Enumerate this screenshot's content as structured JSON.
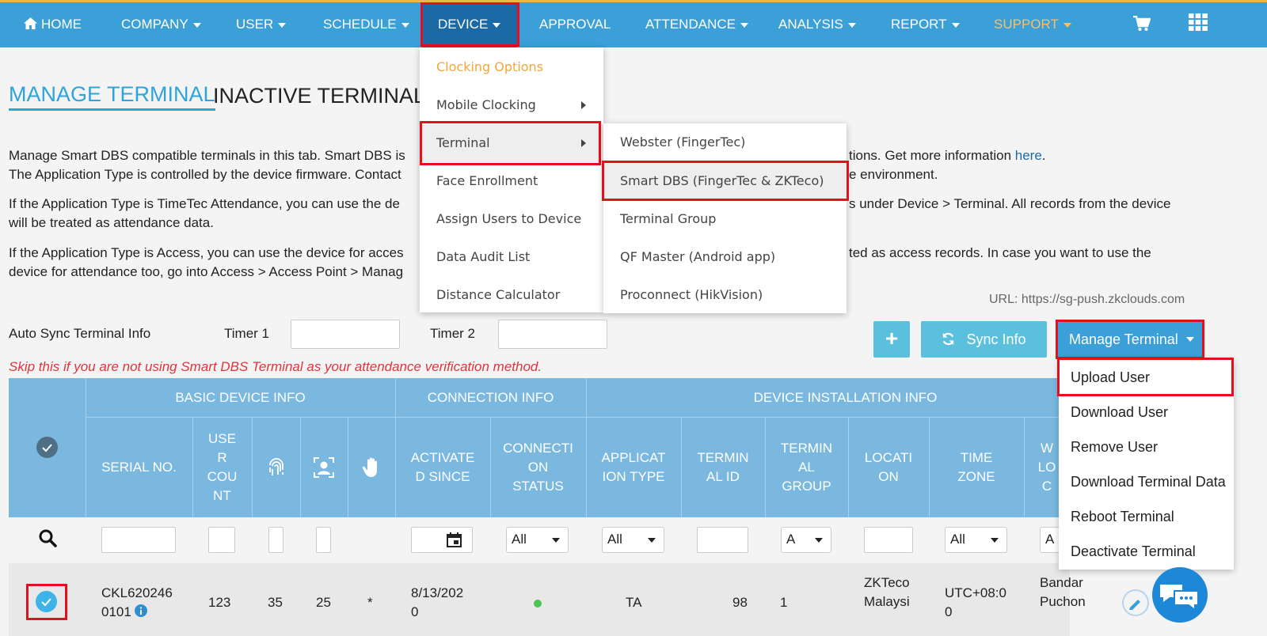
{
  "nav": {
    "items": [
      {
        "label": "HOME",
        "caret": false
      },
      {
        "label": "COMPANY",
        "caret": true
      },
      {
        "label": "USER",
        "caret": true
      },
      {
        "label": "SCHEDULE",
        "caret": true
      },
      {
        "label": "DEVICE",
        "caret": true
      },
      {
        "label": "APPROVAL",
        "caret": false
      },
      {
        "label": "ATTENDANCE",
        "caret": true
      },
      {
        "label": "ANALYSIS",
        "caret": true
      },
      {
        "label": "REPORT",
        "caret": true
      },
      {
        "label": "SUPPORT",
        "caret": true
      }
    ],
    "icons": [
      "home-icon",
      "cart-icon",
      "grid-apps-icon"
    ],
    "colors": {
      "bar": "#3b9fd8",
      "active": "#1b6aa5",
      "support": "#f5c26b",
      "accent": "#e7b84a"
    }
  },
  "tabs": {
    "manage": "MANAGE TERMINAL",
    "inactive": "INACTIVE TERMINAL"
  },
  "intro": {
    "line1a": "Manage Smart DBS compatible terminals in this tab. Smart DBS is",
    "line1b": "tions. Get more information",
    "line1_link": "here",
    "line1_end": ".",
    "line2a": "The Application Type is controlled by the device firmware. Contact",
    "line2b": "e environment.",
    "p2a": "If the Application Type is TimeTec Attendance, you can use the de",
    "p2b": "s under Device > Terminal. All records from the device",
    "p2c": "will be treated as attendance data.",
    "p3a": "If the Application Type is Access, you can use the device for acces",
    "p3b": "ted as access records. In case you want to use the",
    "p3c": "device for attendance too, go into Access > Access Point > Manag"
  },
  "device_menu": {
    "items": [
      {
        "label": "Clocking Options",
        "submenu": false
      },
      {
        "label": "Mobile Clocking",
        "submenu": true
      },
      {
        "label": "Terminal",
        "submenu": true
      },
      {
        "label": "Face Enrollment",
        "submenu": false
      },
      {
        "label": "Assign Users to Device",
        "submenu": false
      },
      {
        "label": "Data Audit List",
        "submenu": false
      },
      {
        "label": "Distance Calculator",
        "submenu": false
      }
    ]
  },
  "terminal_submenu": {
    "items": [
      "Webster (FingerTec)",
      "Smart DBS (FingerTec & ZKTeco)",
      "Terminal Group",
      "QF Master (Android app)",
      "Proconnect (HikVision)"
    ]
  },
  "url_text": "URL: https://sg-push.zkclouds.com",
  "sync": {
    "label": "Auto Sync Terminal Info",
    "timer1": "Timer 1",
    "timer2": "Timer 2"
  },
  "buttons": {
    "add": "+",
    "sync_info": "Sync Info",
    "manage_terminal": "Manage Terminal"
  },
  "warning": "Skip this if you are not using Smart DBS Terminal as your attendance verification method.",
  "manage_menu": {
    "items": [
      "Upload User",
      "Download User",
      "Remove User",
      "Download Terminal Data",
      "Reboot Terminal",
      "Deactivate Terminal"
    ]
  },
  "table": {
    "groups": {
      "basic": "BASIC DEVICE INFO",
      "connection": "CONNECTION INFO",
      "installation": "DEVICE INSTALLATION INFO"
    },
    "headers": {
      "serial": "SERIAL NO.",
      "user_count": "USE\nR\nCOU\nNT",
      "activated": "ACTIVATE\nD SINCE",
      "conn_status": "CONNECTI\nON\nSTATUS",
      "app_type": "APPLICAT\nION TYPE",
      "terminal_id": "TERMIN\nAL ID",
      "terminal_group": "TERMIN\nAL\nGROUP",
      "location": "LOCATI\nON",
      "timezone": "TIME\nZONE",
      "work_location": "W\nLO\nC"
    },
    "filters": {
      "all": "All",
      "partial": "A"
    },
    "row": {
      "serial": "CKL620246\n0101",
      "user_count": "123",
      "fingerprint": "35",
      "face": "25",
      "palm": "*",
      "activated": "8/13/202\n0",
      "app_type": "TA",
      "terminal_id": "98",
      "terminal_group": "1",
      "location": "ZKTeco\nMalaysi",
      "timezone": "UTC+08:0\n0",
      "work_location": "Bandar\nPuchon"
    },
    "colors": {
      "header": "#7ab8e0",
      "status_online": "#4cc352"
    }
  }
}
